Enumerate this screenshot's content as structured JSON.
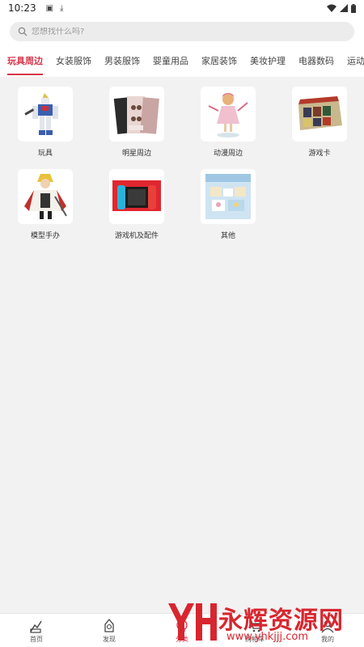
{
  "status_bar": {
    "time": "10:23"
  },
  "search": {
    "placeholder": "您想找什么吗?"
  },
  "tabs": [
    {
      "label": "玩具周边",
      "active": true
    },
    {
      "label": "女装服饰",
      "active": false
    },
    {
      "label": "男装服饰",
      "active": false
    },
    {
      "label": "婴童用品",
      "active": false
    },
    {
      "label": "家居装饰",
      "active": false
    },
    {
      "label": "美妆护理",
      "active": false
    },
    {
      "label": "电器数码",
      "active": false
    },
    {
      "label": "运动",
      "active": false
    }
  ],
  "categories": [
    {
      "label": "玩具"
    },
    {
      "label": "明星周边"
    },
    {
      "label": "动漫周边"
    },
    {
      "label": "游戏卡"
    },
    {
      "label": "模型手办"
    },
    {
      "label": "游戏机及配件"
    },
    {
      "label": "其他"
    }
  ],
  "bottom_nav": [
    {
      "label": "首页",
      "icon": "home-icon"
    },
    {
      "label": "发现",
      "icon": "discover-icon"
    },
    {
      "label": "分类",
      "icon": "category-icon"
    },
    {
      "label": "购物车",
      "icon": "cart-icon"
    },
    {
      "label": "我的",
      "icon": "profile-icon"
    }
  ],
  "watermark": {
    "text": "永辉资源网",
    "url": "www.yhkjjj.com"
  },
  "colors": {
    "accent": "#d6364b",
    "watermark": "#d8262f"
  }
}
